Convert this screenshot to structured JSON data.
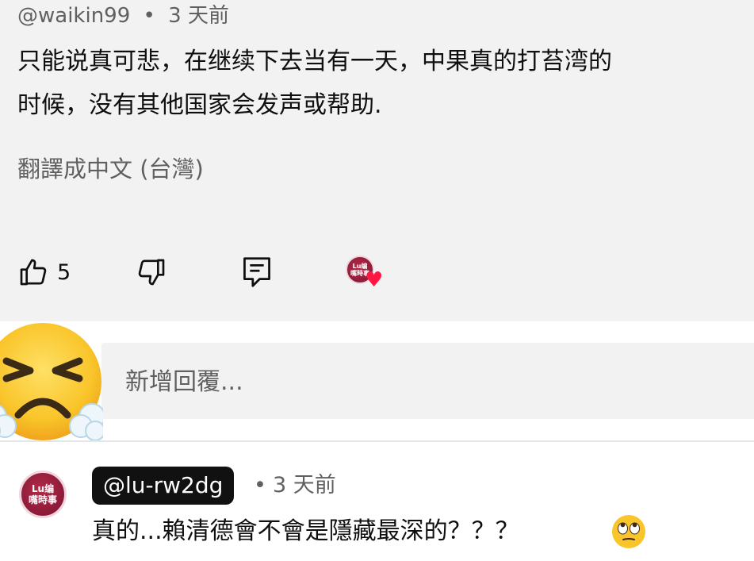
{
  "comment": {
    "author": "@waikin99",
    "separator": "•",
    "time": "3 天前",
    "text_line1": "只能说真可悲，在继续下去当有一天，中果真的打苔湾的",
    "text_line2": "时候，没有其他国家会发声或帮助.",
    "translate_label": "翻譯成中文 (台灣)",
    "like_count": "5",
    "creator_heart_logo_text": [
      "Lu编",
      "嘴時事"
    ]
  },
  "reply_box": {
    "placeholder": "新增回覆...",
    "user_avatar_icon": "persevering-face-emoji"
  },
  "reply": {
    "author": "@lu-rw2dg",
    "separator": "•",
    "time": "3 天前",
    "text": "真的...賴清德會不會是隱藏最深的？？？",
    "trailing_emoji": "face-with-rolling-eyes-emoji",
    "avatar_text_line1": "Lu编",
    "avatar_text_line2": "嘴時事"
  },
  "colors": {
    "card_bg": "#f2f2f2",
    "secondary_text": "#606060",
    "heart": "#ff1744",
    "brand_red": "#9b1f3e",
    "chip_bg": "#111111"
  }
}
